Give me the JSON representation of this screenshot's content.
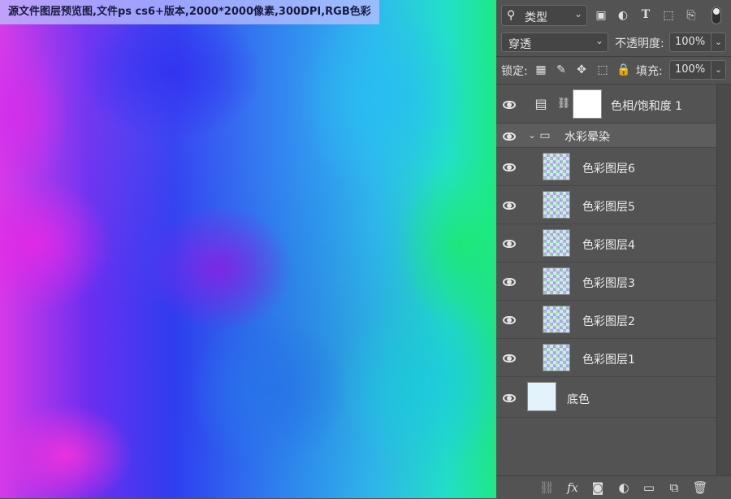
{
  "caption": "源文件图层预览图,文件ps cs6+版本,2000*2000像素,300DPI,RGB色彩",
  "panel": {
    "filter": {
      "kind": "类型",
      "search_icon": "magnifier-icon"
    },
    "filter_icons": [
      "image-filter-icon",
      "adjustment-filter-icon",
      "type-filter-icon",
      "shape-filter-icon",
      "smart-object-filter-icon"
    ],
    "blend_mode": "穿透",
    "opacity_label": "不透明度:",
    "opacity_value": "100%",
    "lock_label": "锁定:",
    "fill_label": "填充:",
    "fill_value": "100%",
    "layers": [
      {
        "name": "色相/饱和度 1",
        "type": "adjustment"
      },
      {
        "name": "水彩晕染",
        "type": "group"
      },
      {
        "name": "色彩图层6",
        "type": "layer"
      },
      {
        "name": "色彩图层5",
        "type": "layer"
      },
      {
        "name": "色彩图层4",
        "type": "layer"
      },
      {
        "name": "色彩图层3",
        "type": "layer"
      },
      {
        "name": "色彩图层2",
        "type": "layer"
      },
      {
        "name": "色彩图层1",
        "type": "layer"
      },
      {
        "name": "底色",
        "type": "layer"
      }
    ],
    "bottom_icons": [
      "link-icon",
      "fx-icon",
      "mask-icon",
      "adjustment-icon",
      "folder-icon",
      "new-layer-icon",
      "trash-icon"
    ]
  },
  "colors": {
    "panel_bg": "#535353",
    "field_bg": "#454545",
    "text": "#e6e6e6"
  }
}
